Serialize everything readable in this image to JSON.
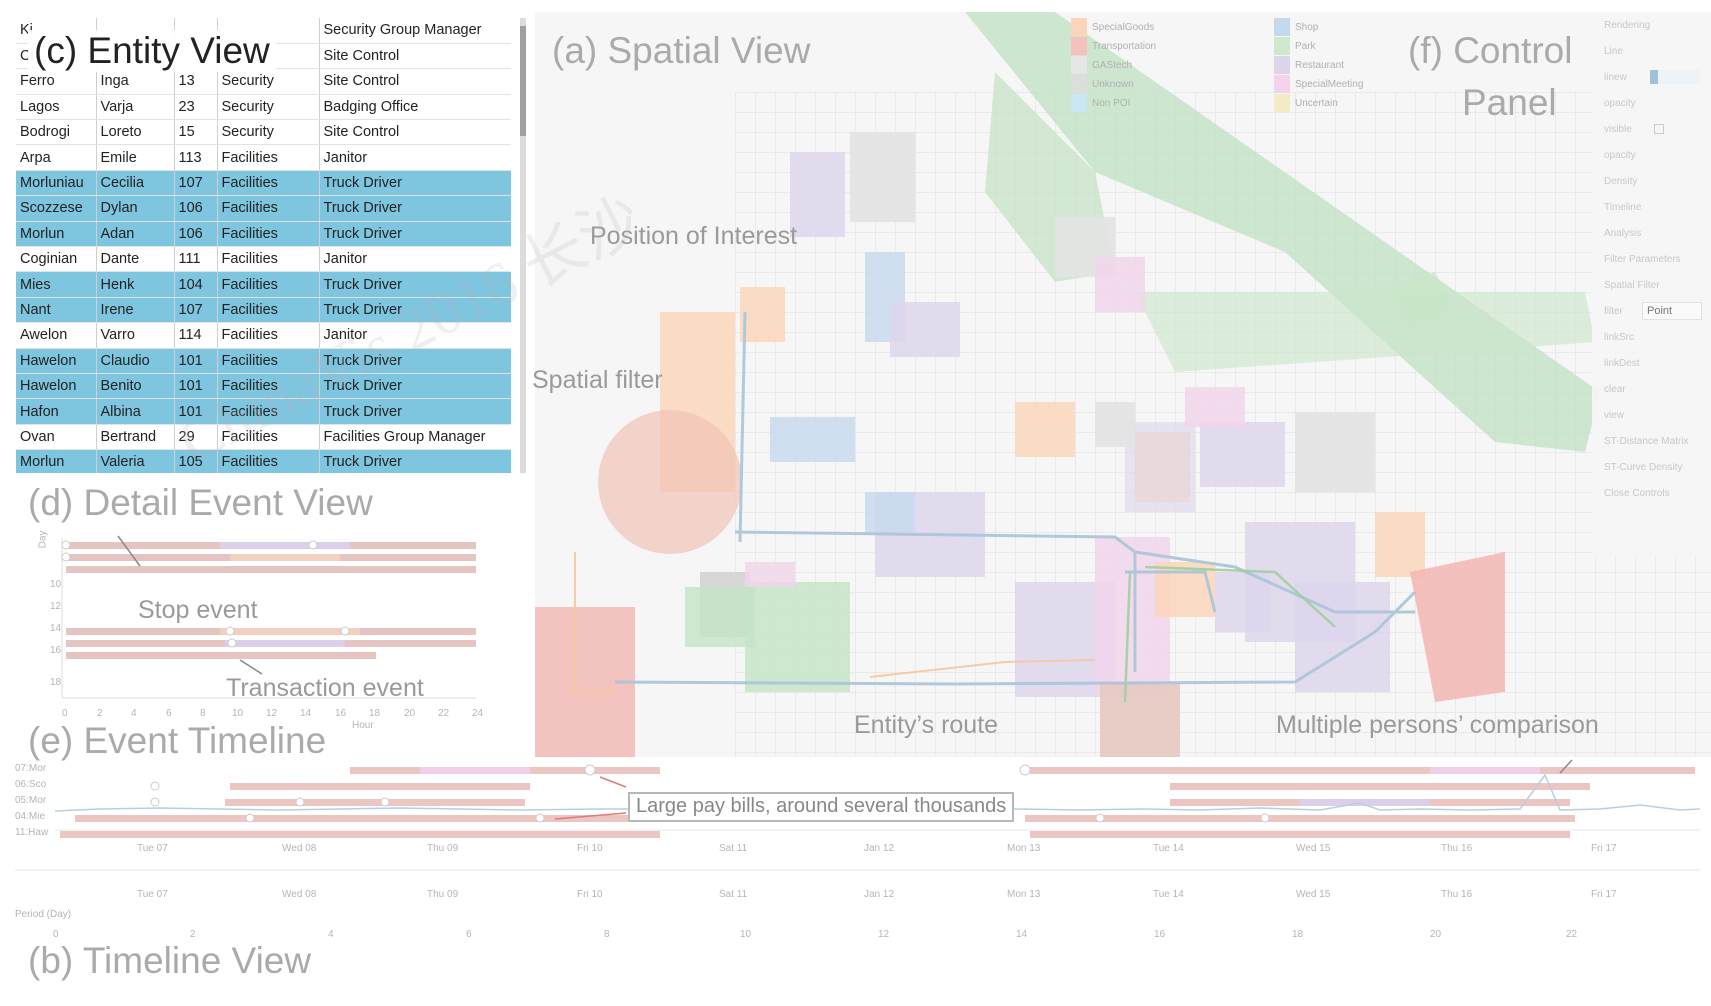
{
  "entity_view": {
    "title": "(c) Entity View",
    "rows": [
      {
        "last": "Ki",
        "first": "",
        "id": "",
        "dept": "",
        "title": "Security Group Manager",
        "highlight": false
      },
      {
        "last": "Ci",
        "first": "",
        "id": "",
        "dept": "",
        "title": "Site Control",
        "highlight": false
      },
      {
        "last": "Ferro",
        "first": "Inga",
        "id": "13",
        "dept": "Security",
        "title": "Site Control",
        "highlight": false
      },
      {
        "last": "Lagos",
        "first": "Varja",
        "id": "23",
        "dept": "Security",
        "title": "Badging Office",
        "highlight": false
      },
      {
        "last": "Bodrogi",
        "first": "Loreto",
        "id": "15",
        "dept": "Security",
        "title": "Site Control",
        "highlight": false
      },
      {
        "last": "Arpa",
        "first": "Emile",
        "id": "113",
        "dept": "Facilities",
        "title": "Janitor",
        "highlight": false
      },
      {
        "last": "Morluniau",
        "first": "Cecilia",
        "id": "107",
        "dept": "Facilities",
        "title": "Truck Driver",
        "highlight": true
      },
      {
        "last": "Scozzese",
        "first": "Dylan",
        "id": "106",
        "dept": "Facilities",
        "title": "Truck Driver",
        "highlight": true
      },
      {
        "last": "Morlun",
        "first": "Adan",
        "id": "106",
        "dept": "Facilities",
        "title": "Truck Driver",
        "highlight": true
      },
      {
        "last": "Coginian",
        "first": "Dante",
        "id": "111",
        "dept": "Facilities",
        "title": "Janitor",
        "highlight": false
      },
      {
        "last": "Mies",
        "first": "Henk",
        "id": "104",
        "dept": "Facilities",
        "title": "Truck Driver",
        "highlight": true
      },
      {
        "last": "Nant",
        "first": "Irene",
        "id": "107",
        "dept": "Facilities",
        "title": "Truck Driver",
        "highlight": true
      },
      {
        "last": "Awelon",
        "first": "Varro",
        "id": "114",
        "dept": "Facilities",
        "title": "Janitor",
        "highlight": false
      },
      {
        "last": "Hawelon",
        "first": "Claudio",
        "id": "101",
        "dept": "Facilities",
        "title": "Truck Driver",
        "highlight": true
      },
      {
        "last": "Hawelon",
        "first": "Benito",
        "id": "101",
        "dept": "Facilities",
        "title": "Truck Driver",
        "highlight": true
      },
      {
        "last": "Hafon",
        "first": "Albina",
        "id": "101",
        "dept": "Facilities",
        "title": "Truck Driver",
        "highlight": true
      },
      {
        "last": "Ovan",
        "first": "Bertrand",
        "id": "29",
        "dept": "Facilities",
        "title": "Facilities Group Manager",
        "highlight": false
      },
      {
        "last": "Morlun",
        "first": "Valeria",
        "id": "105",
        "dept": "Facilities",
        "title": "Truck Driver",
        "highlight": true
      }
    ]
  },
  "spatial_view": {
    "title": "(a) Spatial View",
    "annotations": {
      "poi": "Position of Interest",
      "spatial_filter": "Spatial filter",
      "route": "Entity’s route",
      "comparison": "Multiple persons’ comparison"
    },
    "legend_left": [
      {
        "label": "SpecialGoods",
        "color": "#fbd5b8"
      },
      {
        "label": "Transportation",
        "color": "#f6c0bd"
      },
      {
        "label": "GAStech",
        "color": "#e6e6e6"
      },
      {
        "label": "Unknown",
        "color": "#dddddd"
      },
      {
        "label": "Non POI",
        "color": "#c9e8f2"
      }
    ],
    "legend_right": [
      {
        "label": "Shop",
        "color": "#c5d9ee"
      },
      {
        "label": "Park",
        "color": "#cfe9cf"
      },
      {
        "label": "Restaurant",
        "color": "#ddd5ec"
      },
      {
        "label": "SpecialMeeting",
        "color": "#f3d4ec"
      },
      {
        "label": "Uncertain",
        "color": "#f1ecc5"
      }
    ]
  },
  "control_panel": {
    "title_line1": "(f) Control",
    "title_line2": "Panel",
    "items": [
      "Rendering",
      "Line",
      "linew",
      "opacity",
      "visible",
      "opacity",
      "Density",
      "Timeline",
      "Analysis",
      "Filter Parameters",
      "Spatial Filter",
      "filter",
      "linkSrc",
      "linkDest",
      "clear",
      "view",
      "ST-Distance Matrix",
      "ST-Curve Density",
      "Close Controls"
    ],
    "filter_placeholder": "Point"
  },
  "detail_view": {
    "title": "(d) Detail Event View",
    "ylabel": "Day",
    "xlabel": "Hour",
    "y_ticks": [
      "10",
      "12",
      "14",
      "16",
      "18"
    ],
    "x_ticks": [
      "0",
      "2",
      "4",
      "6",
      "8",
      "10",
      "12",
      "14",
      "16",
      "18",
      "20",
      "22",
      "24"
    ],
    "annotations": {
      "stop": "Stop event",
      "transaction": "Transaction event"
    }
  },
  "event_timeline": {
    "title": "(e) Event Timeline",
    "rows": [
      "07:Mor",
      "06:Sco",
      "05:Mor",
      "04:Mie",
      "11:Haw"
    ],
    "callout": "Large pay bills, around several thousands",
    "day_ticks": [
      "Tue 07",
      "Wed 08",
      "Thu 09",
      "Fri 10",
      "Sat 11",
      "Jan 12",
      "Mon 13",
      "Tue 14",
      "Wed 15",
      "Thu 16",
      "Fri 17"
    ]
  },
  "timeline_view": {
    "title": "(b) Timeline View",
    "period_label": "Period (Day)",
    "period_ticks": [
      "0",
      "2",
      "4",
      "6",
      "8",
      "10",
      "12",
      "14",
      "16",
      "18",
      "20",
      "22"
    ]
  },
  "watermark": "ChinaVis 2016 长沙"
}
